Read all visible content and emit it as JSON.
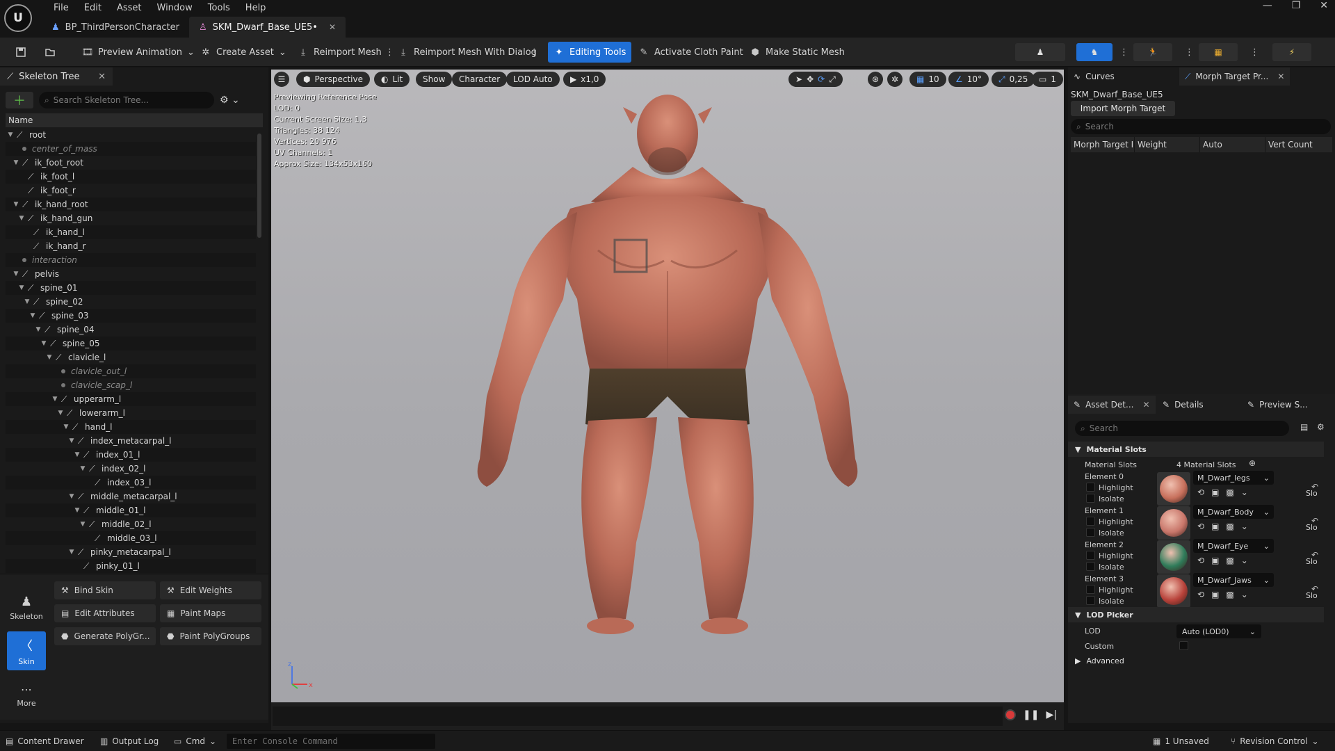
{
  "menu": [
    "File",
    "Edit",
    "Asset",
    "Window",
    "Tools",
    "Help"
  ],
  "tabs": [
    {
      "label": "BP_ThirdPersonCharacter"
    },
    {
      "label": "SKM_Dwarf_Base_UE5•"
    }
  ],
  "toolbar": {
    "preview_animation": "Preview Animation",
    "create_asset": "Create Asset",
    "reimport_mesh": "Reimport Mesh",
    "reimport_dialog": "Reimport Mesh With Dialog",
    "editing_tools": "Editing Tools",
    "activate_cloth": "Activate Cloth Paint",
    "make_static": "Make Static Mesh"
  },
  "skeleton": {
    "tab": "Skeleton Tree",
    "search_placeholder": "Search Skeleton Tree...",
    "name_header": "Name",
    "bones": [
      {
        "name": "root",
        "depth": 0,
        "virtual": false
      },
      {
        "name": "center_of_mass",
        "depth": 1,
        "virtual": true
      },
      {
        "name": "ik_foot_root",
        "depth": 1,
        "virtual": false
      },
      {
        "name": "ik_foot_l",
        "depth": 2,
        "virtual": false
      },
      {
        "name": "ik_foot_r",
        "depth": 2,
        "virtual": false
      },
      {
        "name": "ik_hand_root",
        "depth": 1,
        "virtual": false
      },
      {
        "name": "ik_hand_gun",
        "depth": 2,
        "virtual": false
      },
      {
        "name": "ik_hand_l",
        "depth": 3,
        "virtual": false
      },
      {
        "name": "ik_hand_r",
        "depth": 3,
        "virtual": false
      },
      {
        "name": "interaction",
        "depth": 1,
        "virtual": true
      },
      {
        "name": "pelvis",
        "depth": 1,
        "virtual": false
      },
      {
        "name": "spine_01",
        "depth": 2,
        "virtual": false
      },
      {
        "name": "spine_02",
        "depth": 3,
        "virtual": false
      },
      {
        "name": "spine_03",
        "depth": 4,
        "virtual": false
      },
      {
        "name": "spine_04",
        "depth": 5,
        "virtual": false
      },
      {
        "name": "spine_05",
        "depth": 6,
        "virtual": false
      },
      {
        "name": "clavicle_l",
        "depth": 7,
        "virtual": false
      },
      {
        "name": "clavicle_out_l",
        "depth": 8,
        "virtual": true
      },
      {
        "name": "clavicle_scap_l",
        "depth": 8,
        "virtual": true
      },
      {
        "name": "upperarm_l",
        "depth": 8,
        "virtual": false
      },
      {
        "name": "lowerarm_l",
        "depth": 9,
        "virtual": false
      },
      {
        "name": "hand_l",
        "depth": 10,
        "virtual": false
      },
      {
        "name": "index_metacarpal_l",
        "depth": 11,
        "virtual": false
      },
      {
        "name": "index_01_l",
        "depth": 12,
        "virtual": false
      },
      {
        "name": "index_02_l",
        "depth": 13,
        "virtual": false
      },
      {
        "name": "index_03_l",
        "depth": 14,
        "virtual": false
      },
      {
        "name": "middle_metacarpal_l",
        "depth": 11,
        "virtual": false
      },
      {
        "name": "middle_01_l",
        "depth": 12,
        "virtual": false
      },
      {
        "name": "middle_02_l",
        "depth": 13,
        "virtual": false
      },
      {
        "name": "middle_03_l",
        "depth": 14,
        "virtual": false
      },
      {
        "name": "pinky_metacarpal_l",
        "depth": 11,
        "virtual": false
      },
      {
        "name": "pinky_01_l",
        "depth": 12,
        "virtual": false
      }
    ]
  },
  "modes": {
    "skeleton": "Skeleton",
    "skin": "Skin",
    "more": "More"
  },
  "tools": {
    "bind_skin": "Bind Skin",
    "edit_weights": "Edit Weights",
    "edit_attributes": "Edit Attributes",
    "paint_maps": "Paint Maps",
    "generate_polygroups": "Generate PolyGr...",
    "paint_polygroups": "Paint PolyGroups"
  },
  "viewport": {
    "perspective": "Perspective",
    "lit": "Lit",
    "show": "Show",
    "character": "Character",
    "lod": "LOD Auto",
    "speed": "x1,0",
    "grid": "10",
    "angle": "10°",
    "scale": "0,25",
    "camera": "1",
    "info": [
      "Previewing Reference Pose",
      "LOD: 0",
      "Current Screen Size: 1,3",
      "Triangles: 38 124",
      "Vertices: 20 976",
      "UV Channels: 1",
      "Approx Size: 134x53x160"
    ]
  },
  "right": {
    "curves_tab": "Curves",
    "morph_tab": "Morph Target Pr...",
    "asset_name": "SKM_Dwarf_Base_UE5",
    "import_morph": "Import Morph Target",
    "search_placeholder": "Search",
    "cols": [
      "Morph Target I",
      "Weight",
      "Auto",
      "Vert Count"
    ]
  },
  "details": {
    "asset_tab": "Asset Det...",
    "details_tab": "Details",
    "preview_tab": "Preview S...",
    "search_placeholder": "Search",
    "material_section": "Material Slots",
    "material_slots_label": "Material Slots",
    "material_slots_value": "4 Material Slots",
    "highlight": "Highlight",
    "isolate": "Isolate",
    "slot_suffix": "Slo",
    "elements": [
      {
        "label": "Element 0",
        "material": "M_Dwarf_legs",
        "color": "#c7705c"
      },
      {
        "label": "Element 1",
        "material": "M_Dwarf_Body",
        "color": "#c8766a"
      },
      {
        "label": "Element 2",
        "material": "M_Dwarf_Eye",
        "color": "#2f7c5a"
      },
      {
        "label": "Element 3",
        "material": "M_Dwarf_Jaws",
        "color": "#b8423a"
      }
    ],
    "lod_section": "LOD Picker",
    "lod_label": "LOD",
    "lod_value": "Auto (LOD0)",
    "custom_label": "Custom",
    "advanced": "Advanced"
  },
  "status": {
    "content_drawer": "Content Drawer",
    "output_log": "Output Log",
    "cmd": "Cmd",
    "console_placeholder": "Enter Console Command",
    "unsaved": "1 Unsaved",
    "revision": "Revision Control"
  },
  "colors": {
    "accent": "#1f6fd6",
    "record": "#d83a3a"
  }
}
